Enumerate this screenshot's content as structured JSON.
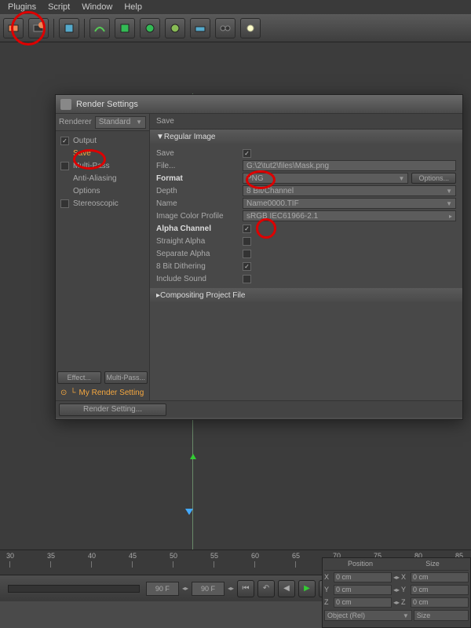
{
  "menu": {
    "plugins": "Plugins",
    "script": "Script",
    "window": "Window",
    "help": "Help"
  },
  "dialog": {
    "title": "Render Settings",
    "renderer_label": "Renderer",
    "renderer_value": "Standard",
    "categories": {
      "output": "Output",
      "save": "Save",
      "multipass": "Multi-Pass",
      "antialias": "Anti-Aliasing",
      "options": "Options",
      "stereo": "Stereoscopic"
    },
    "effect_btn": "Effect...",
    "multipass_btn": "Multi-Pass...",
    "my_render": "My Render Setting",
    "footer_btn": "Render Setting...",
    "save_panel": {
      "header": "Save",
      "section1": "Regular Image",
      "section2": "Compositing Project File",
      "rows": {
        "save_lbl": "Save",
        "file_lbl": "File...",
        "file_val": "G:\\2\\tut2\\files\\Mask.png",
        "format_lbl": "Format",
        "format_val": "PNG",
        "options_btn": "Options...",
        "depth_lbl": "Depth",
        "depth_val": "8 Bit/Channel",
        "name_lbl": "Name",
        "name_val": "Name0000.TIF",
        "icp_lbl": "Image Color Profile",
        "icp_val": "sRGB IEC61966-2.1",
        "alpha_lbl": "Alpha Channel",
        "straight_lbl": "Straight Alpha",
        "separate_lbl": "Separate Alpha",
        "dither_lbl": "8 Bit Dithering",
        "sound_lbl": "Include Sound"
      }
    }
  },
  "timeline": {
    "ticks": [
      "30",
      "35",
      "40",
      "45",
      "50",
      "55",
      "60",
      "65",
      "70",
      "75",
      "80",
      "85"
    ],
    "frame": "90 F"
  },
  "coords": {
    "pos_hdr": "Position",
    "size_hdr": "Size",
    "x": "X",
    "y": "Y",
    "z": "Z",
    "val": "0 cm",
    "obj_sel": "Object (Rel)",
    "size_sel": "Size"
  }
}
